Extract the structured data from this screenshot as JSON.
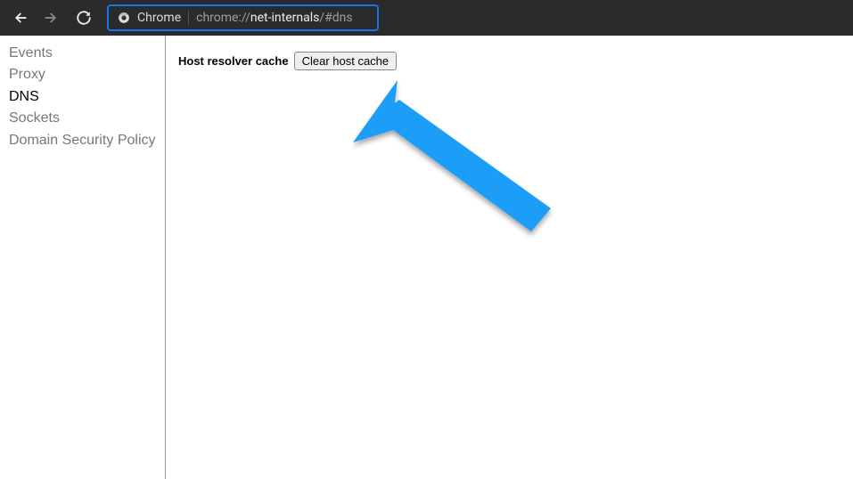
{
  "toolbar": {
    "chrome_label": "Chrome",
    "url_prefix": "chrome://",
    "url_host": "net-internals",
    "url_path": "/#dns"
  },
  "sidebar": {
    "items": [
      {
        "label": "Events",
        "active": false
      },
      {
        "label": "Proxy",
        "active": false
      },
      {
        "label": "DNS",
        "active": true
      },
      {
        "label": "Sockets",
        "active": false
      },
      {
        "label": "Domain Security Policy",
        "active": false
      }
    ]
  },
  "main": {
    "cache_label": "Host resolver cache",
    "clear_button": "Clear host cache"
  }
}
